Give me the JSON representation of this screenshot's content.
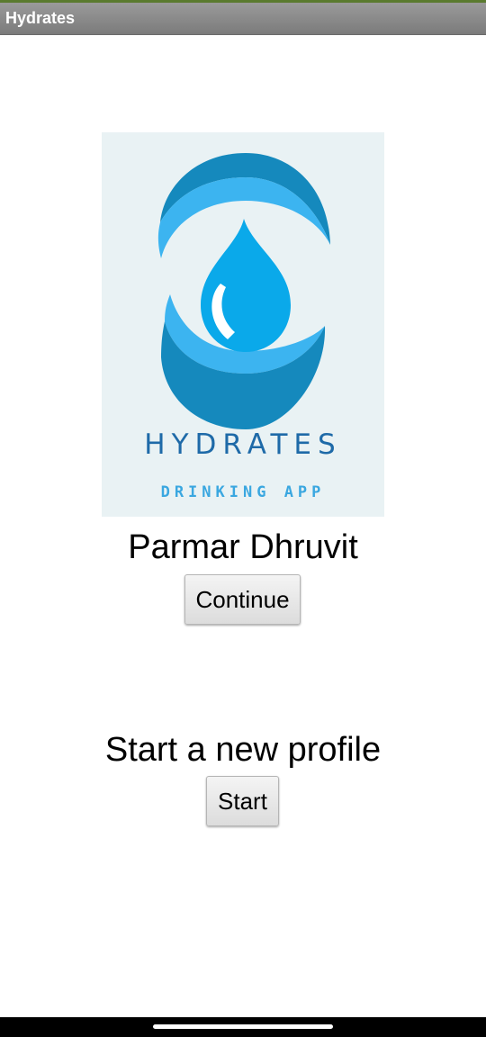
{
  "app": {
    "title": "Hydrates"
  },
  "logo": {
    "icon": "water-drop-logo-icon",
    "wordmark": "HYDRATES",
    "tagline": "DRINKING APP",
    "colors": {
      "background": "#e9f2f4",
      "dark_blue": "#1589bd",
      "light_blue": "#3cb4f0",
      "drop": "#0aa9ea",
      "wordmark": "#1e6aa8",
      "tagline": "#3aa7e0"
    }
  },
  "profile": {
    "name": "Parmar Dhruvit",
    "continue_label": "Continue"
  },
  "new_profile": {
    "heading": "Start a new profile",
    "start_label": "Start"
  },
  "system_nav": {
    "home_indicator": "home-indicator"
  }
}
